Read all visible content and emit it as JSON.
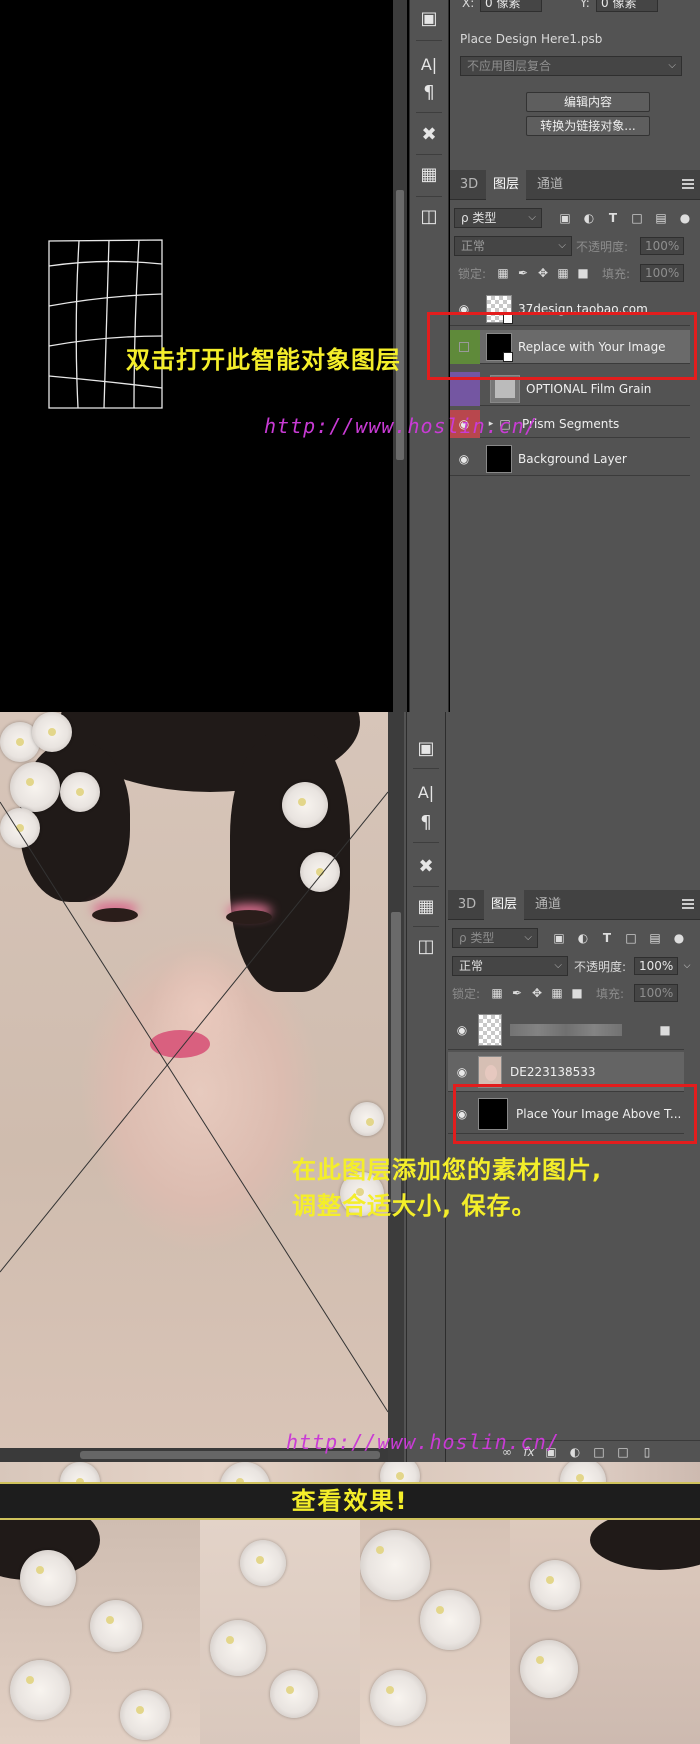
{
  "section1": {
    "toolbar": {
      "icons": [
        "stamp-tool-icon",
        "character-icon",
        "paragraph-icon",
        "tools-icon",
        "swatch-icon",
        "layer-comps-icon"
      ]
    },
    "properties": {
      "x_label": "X:",
      "x_value": "0 像素",
      "y_label": "Y:",
      "y_value": "0 像素",
      "filename": "Place Design Here1.psb",
      "comp_select": "不应用图层复合",
      "edit_button": "编辑内容",
      "convert_button": "转换为链接对象..."
    },
    "layers_panel": {
      "tabs": [
        "3D",
        "图层",
        "通道"
      ],
      "active_tab": "图层",
      "filter_label": "ρ 类型",
      "blend_mode": "正常",
      "opacity_label": "不透明度:",
      "opacity_value": "100%",
      "lock_label": "锁定:",
      "fill_label": "填充:",
      "fill_value": "100%",
      "layers": [
        {
          "name": "37design.taobao.com",
          "visible": true,
          "color": ""
        },
        {
          "name": "Replace with Your Image",
          "visible": false,
          "color": "#5f8a3a",
          "selected": true
        },
        {
          "name": "OPTIONAL Film Grain",
          "visible": false,
          "color": "#7456a2"
        },
        {
          "name": "Prism Segments",
          "visible": true,
          "color": "#b8474d"
        },
        {
          "name": "Background Layer",
          "visible": true,
          "color": ""
        }
      ]
    },
    "annotation": "双击打开此智能对象图层",
    "watermark": "http://www.hoslin.cn/"
  },
  "section2": {
    "layers_panel": {
      "tabs": [
        "3D",
        "图层",
        "通道"
      ],
      "active_tab": "图层",
      "filter_label": "ρ 类型",
      "blend_mode": "正常",
      "opacity_label": "不透明度:",
      "opacity_value": "100%",
      "lock_label": "锁定:",
      "fill_label": "填充:",
      "fill_value": "100%",
      "layers": [
        {
          "name": "",
          "visible": true,
          "locked": true
        },
        {
          "name": "DE223138533",
          "visible": true
        },
        {
          "name": "Place Your Image Above T...",
          "visible": true
        }
      ],
      "footer_icons": [
        "link-icon",
        "fx-icon",
        "mask-icon",
        "adjustment-icon",
        "group-icon",
        "new-layer-icon",
        "trash-icon"
      ]
    },
    "annotation_line1": "在此图层添加您的素材图片,",
    "annotation_line2": "调整合适大小, 保存。",
    "watermark": "http://www.hoslin.cn/"
  },
  "section3": {
    "title": "查看效果!"
  }
}
